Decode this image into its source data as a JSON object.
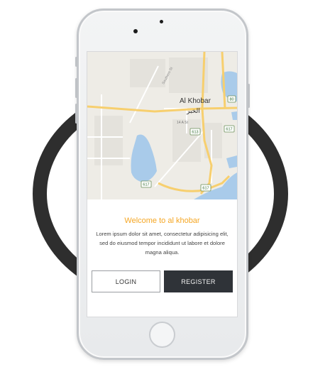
{
  "map": {
    "city_label": "Al Khobar",
    "city_label_arabic": "الخبر",
    "street_label": "Southern St",
    "street_label_2": "14 A St",
    "shields": [
      "80",
      "613",
      "617",
      "617",
      "617"
    ],
    "colors": {
      "land": "#eeece6",
      "water": "#a9cbea",
      "road_major": "#f7cf6e",
      "road_minor": "#ffffff"
    }
  },
  "welcome": {
    "title": "Welcome to al khobar",
    "body": "Lorem ipsum dolor sit amet, consectetur adipisicing elit, sed do eiusmod tempor incididunt ut labore et dolore magna aliqua."
  },
  "buttons": {
    "login": "LOGIN",
    "register": "REGISTER"
  },
  "colors": {
    "accent": "#f5a623",
    "dark_button": "#2f3338",
    "ring": "#2e2e2e"
  }
}
